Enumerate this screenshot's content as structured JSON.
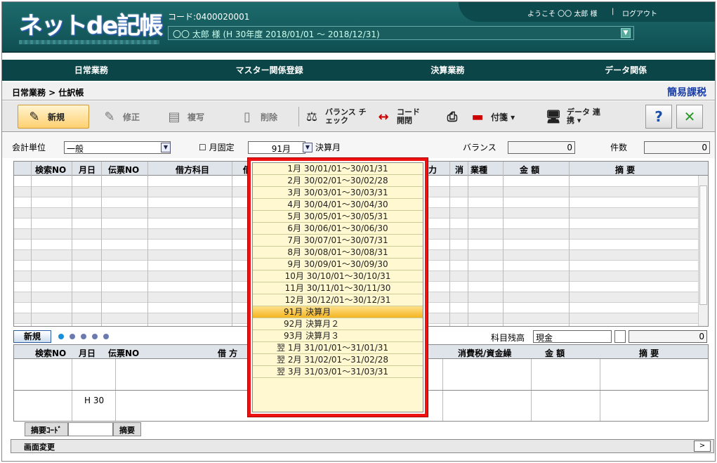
{
  "header": {
    "logo": "ネットde記帳",
    "code": "コード:0400020001",
    "user_period": "〇〇 太郎 様 (H 30年度 2018/01/01 ～ 2018/12/31)",
    "welcome": "ようこそ 〇〇 太郎 様",
    "sep": "|",
    "logout": "ログアウト"
  },
  "menu": [
    "日常業務",
    "マスター関係登録",
    "決算業務",
    "データ関係"
  ],
  "breadcrumb": "日常業務 > 仕訳帳",
  "tax_mode": "簡易課税",
  "toolbar": {
    "new": "新規",
    "edit": "修正",
    "copy": "複写",
    "delete": "削除",
    "balance": "バランス チェック",
    "code_open": "コード 開閉",
    "tag": "付箋 ▾",
    "data_link": "データ 連携 ▾"
  },
  "filter": {
    "unit_label": "会計単位",
    "unit_value": "一般",
    "month_fixed": "月固定",
    "month_value": "91月",
    "month_name": "決算月",
    "balance_label": "バランス",
    "balance_value": "0",
    "count_label": "件数",
    "count_value": "0"
  },
  "grid1_headers": [
    "検索NO",
    "月日",
    "伝票NO",
    "借方科目",
    "借",
    "力",
    "消",
    "業種",
    "金 額",
    "摘 要"
  ],
  "entry": {
    "new_label": "新規",
    "subject_balance_label": "科目残高",
    "subject_value": "現金",
    "subject_amount": "0"
  },
  "grid2_headers": [
    "検索NO",
    "月日",
    "伝票NO",
    "借 方",
    "消費税/資金繰",
    "金 額",
    "摘 要"
  ],
  "grid2_row_text": "H 30",
  "bottom_tabs": [
    "摘要ｺｰﾄﾞ",
    "摘要"
  ],
  "status": {
    "screen_change": "画面変更",
    "next": ">"
  },
  "dropdown_items": [
    "1月 30/01/01～30/01/31",
    "2月 30/02/01～30/02/28",
    "3月 30/03/01～30/03/31",
    "4月 30/04/01～30/04/30",
    "5月 30/05/01～30/05/31",
    "6月 30/06/01～30/06/30",
    "7月 30/07/01～30/07/31",
    "8月 30/08/01～30/08/31",
    "9月 30/09/01～30/09/30",
    "10月 30/10/01～30/10/31",
    "11月 30/11/01～30/11/30",
    "12月 30/12/01～30/12/31",
    "91月 決算月",
    "92月 決算月２",
    "93月 決算月３",
    "翌 1月 31/01/01～31/01/31",
    "翌 2月 31/02/01～31/02/28",
    "翌 3月 31/03/01～31/03/31"
  ],
  "dropdown_selected": "91月 決算月",
  "colors": {
    "header": "#0f4f52",
    "highlight": "#f5b520",
    "dropdown_border": "#ee1111"
  }
}
